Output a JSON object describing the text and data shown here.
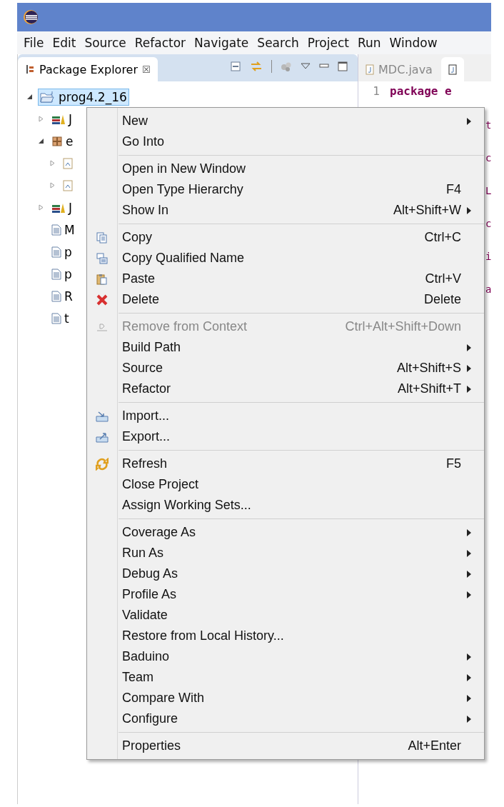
{
  "menubar": [
    "File",
    "Edit",
    "Source",
    "Refactor",
    "Navigate",
    "Search",
    "Project",
    "Run",
    "Window"
  ],
  "explorer": {
    "title": "Package Explorer",
    "close": "☒",
    "tree": [
      {
        "label": "prog4.2_16",
        "kind": "project",
        "expanded": true,
        "selected": true,
        "children": [
          {
            "label": "J",
            "kind": "library",
            "expanded": false,
            "selected": false
          },
          {
            "label": "e",
            "kind": "package",
            "expanded": true,
            "selected": false,
            "children": [
              {
                "kind": "java",
                "expanded": false,
                "selected": false
              },
              {
                "kind": "java",
                "expanded": false,
                "selected": false
              }
            ]
          },
          {
            "label": "J",
            "kind": "library",
            "expanded": false,
            "selected": false
          },
          {
            "label": "M",
            "kind": "file",
            "selected": false
          },
          {
            "label": "p",
            "kind": "file",
            "selected": false
          },
          {
            "label": "p",
            "kind": "file",
            "selected": false
          },
          {
            "label": "R",
            "kind": "file",
            "selected": false
          },
          {
            "label": "t",
            "kind": "file",
            "selected": false
          }
        ]
      }
    ]
  },
  "editor": {
    "tabs": [
      {
        "label": "MDC.java",
        "selected": false
      },
      {
        "selected": true
      }
    ],
    "line_number": "1",
    "code": "package e",
    "fragments": [
      "t",
      "c",
      "L",
      "c",
      "i",
      "a"
    ]
  },
  "context_menu": [
    [
      {
        "label": "New",
        "submenu": true
      },
      {
        "label": "Go Into"
      }
    ],
    [
      {
        "label": "Open in New Window"
      },
      {
        "label": "Open Type Hierarchy",
        "shortcut": "F4"
      },
      {
        "label": "Show In",
        "shortcut": "Alt+Shift+W",
        "submenu": true
      }
    ],
    [
      {
        "label": "Copy",
        "shortcut": "Ctrl+C",
        "kind": "copy"
      },
      {
        "label": "Copy Qualified Name",
        "kind": "copy2"
      },
      {
        "label": "Paste",
        "shortcut": "Ctrl+V",
        "kind": "paste"
      },
      {
        "label": "Delete",
        "shortcut": "Delete",
        "kind": "delete"
      }
    ],
    [
      {
        "label": "Remove from Context",
        "shortcut": "Ctrl+Alt+Shift+Down",
        "kind": "remove",
        "disabled": true
      },
      {
        "label": "Build Path",
        "submenu": true
      },
      {
        "label": "Source",
        "shortcut": "Alt+Shift+S",
        "submenu": true
      },
      {
        "label": "Refactor",
        "shortcut": "Alt+Shift+T",
        "submenu": true
      }
    ],
    [
      {
        "label": "Import...",
        "kind": "import"
      },
      {
        "label": "Export...",
        "kind": "export"
      }
    ],
    [
      {
        "label": "Refresh",
        "shortcut": "F5",
        "kind": "refresh"
      },
      {
        "label": "Close Project"
      },
      {
        "label": "Assign Working Sets..."
      }
    ],
    [
      {
        "label": "Coverage As",
        "submenu": true
      },
      {
        "label": "Run As",
        "submenu": true
      },
      {
        "label": "Debug As",
        "submenu": true
      },
      {
        "label": "Profile As",
        "submenu": true
      },
      {
        "label": "Validate"
      },
      {
        "label": "Restore from Local History..."
      },
      {
        "label": "Baduino",
        "submenu": true
      },
      {
        "label": "Team",
        "submenu": true
      },
      {
        "label": "Compare With",
        "submenu": true
      },
      {
        "label": "Configure",
        "submenu": true
      }
    ],
    [
      {
        "label": "Properties",
        "shortcut": "Alt+Enter"
      }
    ]
  ]
}
